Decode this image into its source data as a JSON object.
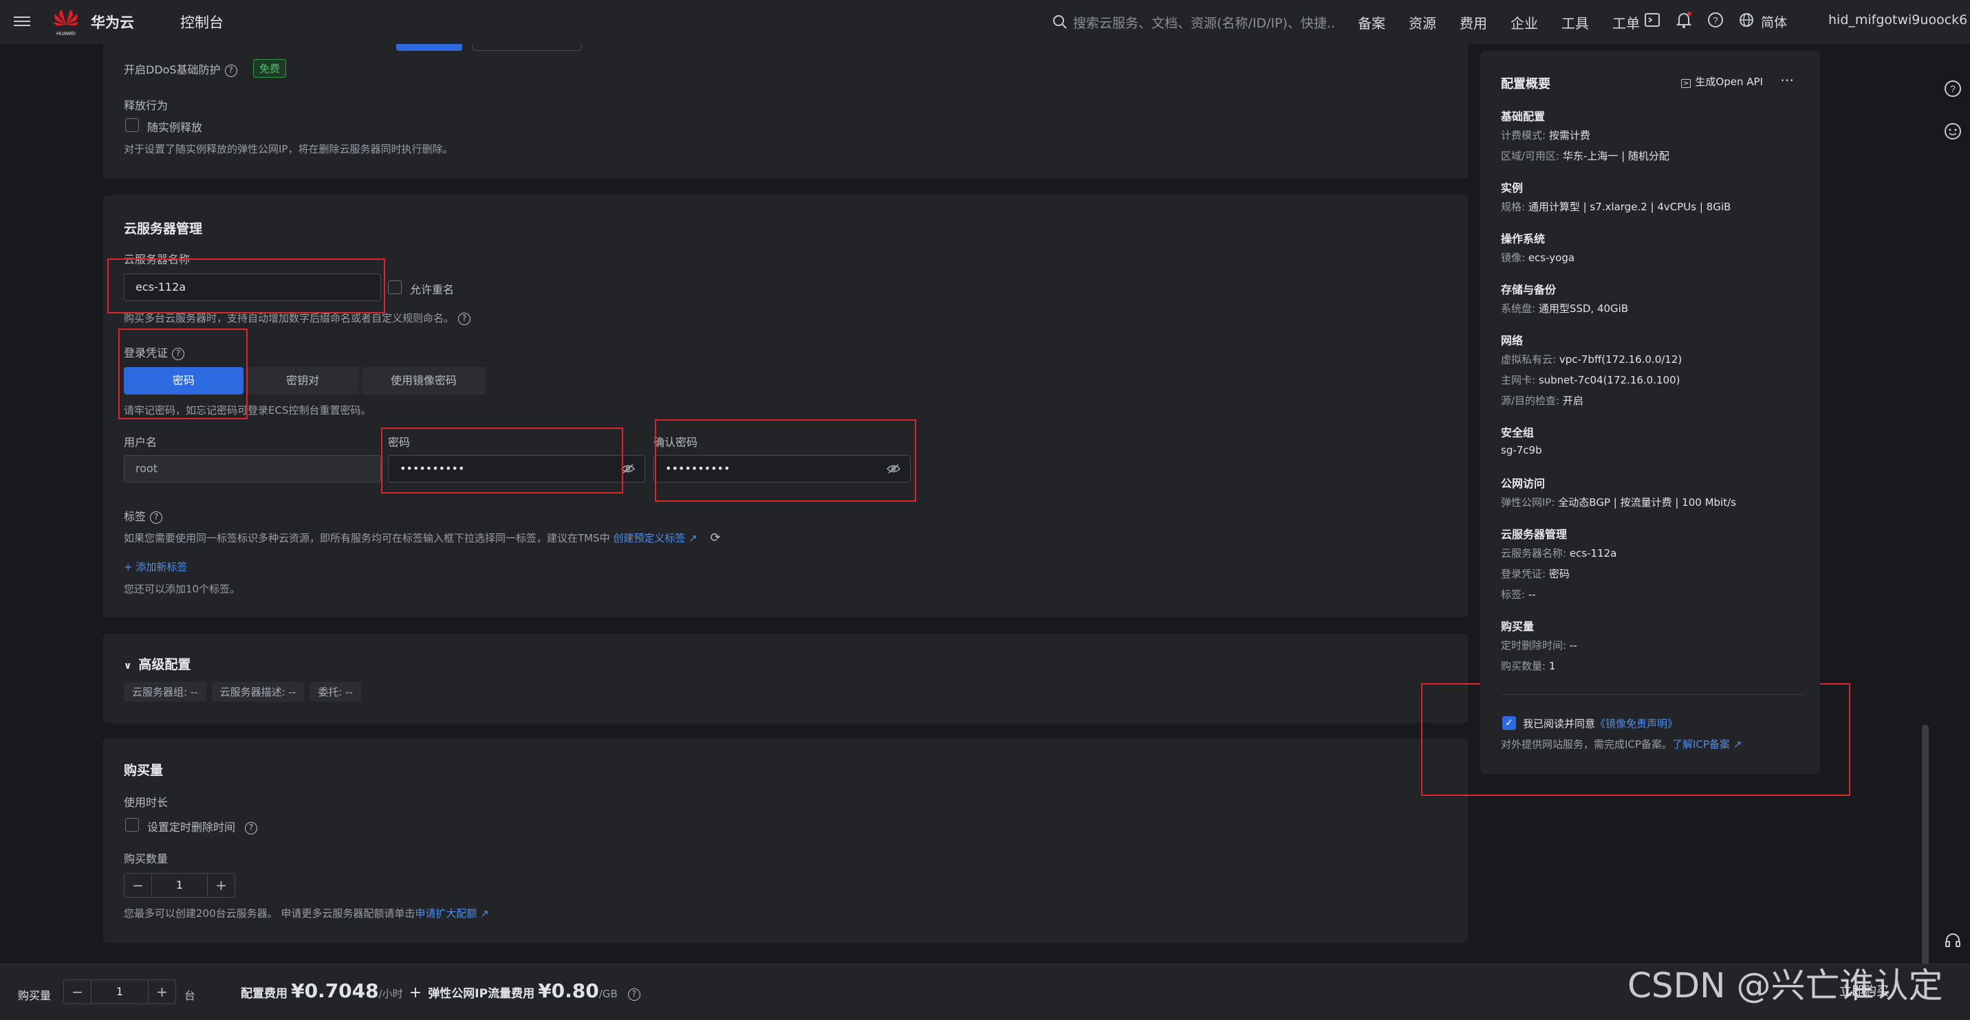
{
  "header": {
    "brand": "华为云",
    "console": "控制台",
    "search_placeholder": "搜索云服务、文档、资源(名称/ID/IP)、快捷...",
    "nav": [
      "备案",
      "资源",
      "费用",
      "企业",
      "工具",
      "工单"
    ],
    "lang": "简体",
    "user": "hid_mifgotwi9uoock6",
    "logo_text": "HUAWEI"
  },
  "ddos": {
    "label": "开启DDoS基础防护",
    "badge": "免费"
  },
  "release": {
    "title": "释放行为",
    "checkbox": "随实例释放",
    "desc": "对于设置了随实例释放的弹性公网IP，将在删除云服务器同时执行删除。"
  },
  "server_mgmt": {
    "title": "云服务器管理",
    "name_label": "云服务器名称",
    "name_value": "ecs-112a",
    "allow_dup": "允许重名",
    "name_hint": "购买多台云服务器时，支持自动增加数字后缀命名或者自定义规则命名。",
    "cred_label": "登录凭证",
    "cred_tabs": [
      "密码",
      "密钥对",
      "使用镜像密码"
    ],
    "cred_hint": "请牢记密码，如忘记密码可登录ECS控制台重置密码。",
    "user_label": "用户名",
    "user_value": "root",
    "pwd_label": "密码",
    "pwd_value": "••••••••••",
    "confirm_label": "确认密码",
    "confirm_value": "••••••••••",
    "tag_label": "标签",
    "tag_desc": "如果您需要使用同一标签标识多种云资源，即所有服务均可在标签输入框下拉选择同一标签，建议在TMS中",
    "tag_link": "创建预定义标签",
    "add_tag": "添加新标签",
    "tag_limit": "您还可以添加10个标签。"
  },
  "advanced": {
    "title": "高级配置",
    "tags": [
      "云服务器组: --",
      "云服务器描述: --",
      "委托: --"
    ]
  },
  "purchase": {
    "title": "购买量",
    "duration_label": "使用时长",
    "timed_delete": "设置定时删除时间",
    "qty_label": "购买数量",
    "qty": "1",
    "limit_text": "您最多可以创建200台云服务器。 申请更多云服务器配额请单击",
    "limit_link": "申请扩大配额"
  },
  "summary": {
    "title": "配置概要",
    "openapi": "生成Open API",
    "sections": [
      {
        "title": "基础配置",
        "rows": [
          [
            "计费模式: ",
            "按需计费"
          ],
          [
            "区域/可用区: ",
            "华东-上海一 | 随机分配"
          ]
        ]
      },
      {
        "title": "实例",
        "rows": [
          [
            "规格: ",
            "通用计算型 | s7.xlarge.2 | 4vCPUs | 8GiB"
          ]
        ]
      },
      {
        "title": "操作系统",
        "rows": [
          [
            "镜像: ",
            "ecs-yoga"
          ]
        ]
      },
      {
        "title": "存储与备份",
        "rows": [
          [
            "系统盘: ",
            "通用型SSD, 40GiB"
          ]
        ]
      },
      {
        "title": "网络",
        "rows": [
          [
            "虚拟私有云: ",
            "vpc-7bff(172.16.0.0/12)"
          ],
          [
            "主网卡: ",
            "subnet-7c04(172.16.0.100)"
          ],
          [
            "源/目的检查: ",
            "开启"
          ]
        ]
      },
      {
        "title": "安全组",
        "rows": [
          [
            "",
            "sg-7c9b"
          ]
        ]
      },
      {
        "title": "公网访问",
        "rows": [
          [
            "弹性公网IP: ",
            "全动态BGP | 按流量计费 | 100 Mbit/s"
          ]
        ]
      },
      {
        "title": "云服务器管理",
        "rows": [
          [
            "云服务器名称: ",
            "ecs-112a"
          ],
          [
            "登录凭证: ",
            "密码"
          ],
          [
            "标签: ",
            "--"
          ]
        ]
      },
      {
        "title": "购买量",
        "rows": [
          [
            "定时删除时间: ",
            "--"
          ],
          [
            "购买数量: ",
            "1"
          ]
        ]
      }
    ],
    "agree_prefix": "我已阅读并同意",
    "agree_link": "《镜像免责声明》",
    "icp_text": "对外提供网站服务，需完成ICP备案。",
    "icp_link": "了解ICP备案"
  },
  "bottom": {
    "qty_label": "购买量",
    "qty": "1",
    "unit": "台",
    "cfg_label": "配置费用",
    "cfg_price": "¥0.7048",
    "cfg_unit": "/小时",
    "plus": "+",
    "eip_label": "弹性公网IP流量费用",
    "eip_price": "¥0.80",
    "eip_unit": "/GB",
    "buy": "立即购买"
  },
  "watermark": "CSDN @兴亡谁认定",
  "colors": {
    "accent": "#2d6ae0",
    "link": "#4c8ff0",
    "red_annotation": "#e0242c",
    "free_badge": "#2f9a4a"
  }
}
